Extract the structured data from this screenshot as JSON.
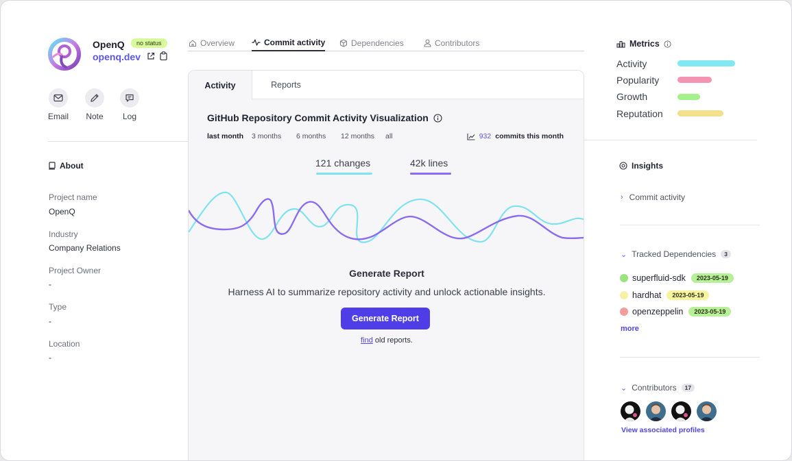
{
  "profile": {
    "name": "OpenQ",
    "status_badge": "no status",
    "link": "openq.dev",
    "link_icon": "external-link-icon",
    "copy_icon": "copy-icon"
  },
  "actions": [
    {
      "label": "Email",
      "icon": "mail-icon"
    },
    {
      "label": "Note",
      "icon": "pencil-icon"
    },
    {
      "label": "Log",
      "icon": "message-icon"
    }
  ],
  "about": {
    "title": "About",
    "fields": [
      {
        "label": "Project name",
        "value": "OpenQ"
      },
      {
        "label": "Industry",
        "value": "Company Relations"
      },
      {
        "label": "Project Owner",
        "value": "-"
      },
      {
        "label": "Type",
        "value": "-"
      },
      {
        "label": "Location",
        "value": "-"
      }
    ]
  },
  "nav": {
    "tabs": [
      {
        "label": "Overview",
        "icon": "home-icon"
      },
      {
        "label": "Commit activity",
        "icon": "activity-icon"
      },
      {
        "label": "Dependencies",
        "icon": "package-icon"
      },
      {
        "label": "Contributors",
        "icon": "user-icon"
      }
    ],
    "active": "Commit activity"
  },
  "panel": {
    "tabs": [
      "Activity",
      "Reports"
    ],
    "title": "GitHub Repository Commit Activity Visualization",
    "ranges": [
      "last month",
      "3 months",
      "6 months",
      "12 months",
      "all"
    ],
    "selected_range": "last month",
    "commits_count": "932",
    "commits_suffix": "commits this month",
    "legend": [
      {
        "label": "121 changes",
        "color": "#7fe3ef"
      },
      {
        "label": "42k lines",
        "color": "#8b6cf0"
      }
    ],
    "report": {
      "title": "Generate Report",
      "description": "Harness AI to summarize repository activity and unlock actionable insights.",
      "button": "Generate Report",
      "find_link": "find",
      "find_suffix": "old reports."
    }
  },
  "metrics": {
    "title": "Metrics",
    "items": [
      {
        "label": "Activity",
        "color": "#7fe8f2",
        "level": 0.84
      },
      {
        "label": "Popularity",
        "color": "#f593b3",
        "level": 0.5
      },
      {
        "label": "Growth",
        "color": "#a3f08c",
        "level": 0.33
      },
      {
        "label": "Reputation",
        "color": "#f3df8c",
        "level": 0.67
      }
    ]
  },
  "insights": {
    "title": "Insights",
    "items": [
      "Commit activity"
    ]
  },
  "dependencies": {
    "title": "Tracked Dependencies",
    "count": "3",
    "items": [
      {
        "name": "superfluid-sdk",
        "date": "2023-05-19",
        "dot_color": "#9be37f",
        "badge_color": "#b8f09a"
      },
      {
        "name": "hardhat",
        "date": "2023-05-19",
        "dot_color": "#f7f1a6",
        "badge_color": "#f7f39e"
      },
      {
        "name": "openzeppelin",
        "date": "2023-05-19",
        "dot_color": "#f29c9c",
        "badge_color": "#b8f09a"
      }
    ],
    "more": "more"
  },
  "contributors": {
    "title": "Contributors",
    "count": "17",
    "link": "View associated profiles"
  }
}
